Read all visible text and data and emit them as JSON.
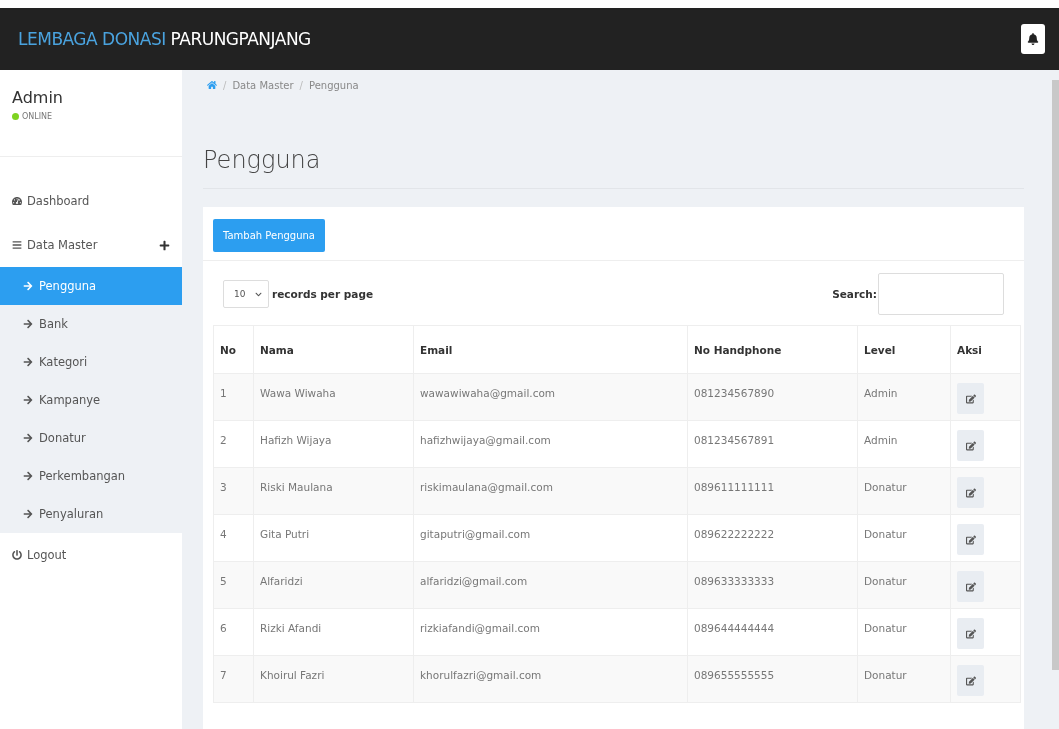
{
  "header": {
    "brand_accent": "LEMBAGA DONASI",
    "brand_rest": "PARUNGPANJANG"
  },
  "user": {
    "name": "Admin",
    "status": "ONLINE",
    "color": "#7ed321"
  },
  "sidebar": {
    "items": [
      {
        "label": "Dashboard",
        "kind": "dashboard"
      },
      {
        "label": "Data Master",
        "kind": "group",
        "children": [
          {
            "label": "Pengguna",
            "selected": true
          },
          {
            "label": "Bank",
            "selected": false
          },
          {
            "label": "Kategori",
            "selected": false
          },
          {
            "label": "Kampanye",
            "selected": false
          },
          {
            "label": "Donatur",
            "selected": false
          },
          {
            "label": "Perkembangan",
            "selected": false
          },
          {
            "label": "Penyaluran",
            "selected": false
          }
        ]
      },
      {
        "label": "Logout",
        "kind": "logout"
      }
    ]
  },
  "breadcrumb": {
    "separator": "/",
    "items": [
      "Data Master",
      "Pengguna"
    ]
  },
  "page_title": "Pengguna",
  "add_button": "Tambah Pengguna",
  "page_size": {
    "value": "10",
    "label": "records per page"
  },
  "search": {
    "label": "Search:"
  },
  "table": {
    "columns": [
      "No",
      "Nama",
      "Email",
      "No Handphone",
      "Level",
      "Aksi"
    ],
    "rows": [
      [
        "1",
        "Wawa Wiwaha",
        "wawawiwaha@gmail.com",
        "081234567890",
        "Admin"
      ],
      [
        "2",
        "Hafizh Wijaya",
        "hafizhwijaya@gmail.com",
        "081234567891",
        "Admin"
      ],
      [
        "3",
        "Riski Maulana",
        "riskimaulana@gmail.com",
        "089611111111",
        "Donatur"
      ],
      [
        "4",
        "Gita Putri",
        "gitaputri@gmail.com",
        "089622222222",
        "Donatur"
      ],
      [
        "5",
        "Alfaridzi",
        "alfaridzi@gmail.com",
        "089633333333",
        "Donatur"
      ],
      [
        "6",
        "Rizki Afandi",
        "rizkiafandi@gmail.com",
        "089644444444",
        "Donatur"
      ],
      [
        "7",
        "Khoirul Fazri",
        "khorulfazri@gmail.com",
        "089655555555",
        "Donatur"
      ]
    ]
  }
}
